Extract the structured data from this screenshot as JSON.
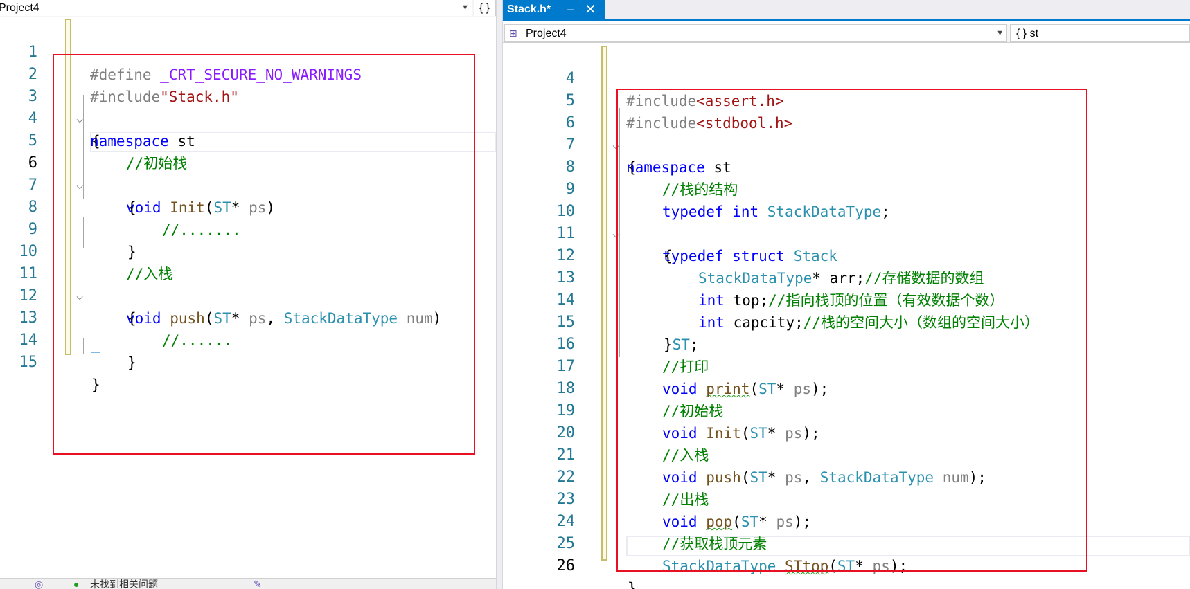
{
  "left_editor": {
    "project_combo": "Project4",
    "member_combo": "{ }",
    "lines": [
      {
        "n": "1"
      },
      {
        "n": "2"
      },
      {
        "n": "3"
      },
      {
        "n": "4"
      },
      {
        "n": "5"
      },
      {
        "n": "6"
      },
      {
        "n": "7"
      },
      {
        "n": "8"
      },
      {
        "n": "9"
      },
      {
        "n": "10"
      },
      {
        "n": "11"
      },
      {
        "n": "12"
      },
      {
        "n": "13"
      },
      {
        "n": "14"
      },
      {
        "n": "15"
      }
    ],
    "tokens": {
      "define": "#define",
      "crt_macro": "_CRT_SECURE_NO_WARNINGS",
      "include": "#include",
      "stack_h": "\"Stack.h\"",
      "namespace": "namespace",
      "st": " st",
      "lbrace": "{",
      "rbrace": "}",
      "cm_init": "//初始栈",
      "void": "void",
      "init": "Init",
      "lparen": "(",
      "ST": "ST",
      "star": "*",
      "ps": "ps",
      "rparen": ")",
      "comma": ",",
      "dots7": "//.......",
      "cm_push": "//入栈",
      "push": "push",
      "sdt": "StackDataType",
      "num": "num",
      "dots6": "//......"
    }
  },
  "right_editor": {
    "tab_label": "Stack.h*",
    "tab_pin": "⊣",
    "tab_close": "✕",
    "project_combo": "Project4",
    "member_combo": "{ } st",
    "lines": [
      {
        "n": "4"
      },
      {
        "n": "5"
      },
      {
        "n": "6"
      },
      {
        "n": "7"
      },
      {
        "n": "8"
      },
      {
        "n": "9"
      },
      {
        "n": "10"
      },
      {
        "n": "11"
      },
      {
        "n": "12"
      },
      {
        "n": "13"
      },
      {
        "n": "14"
      },
      {
        "n": "15"
      },
      {
        "n": "16"
      },
      {
        "n": "17"
      },
      {
        "n": "18"
      },
      {
        "n": "19"
      },
      {
        "n": "20"
      },
      {
        "n": "21"
      },
      {
        "n": "22"
      },
      {
        "n": "23"
      },
      {
        "n": "24"
      },
      {
        "n": "25"
      },
      {
        "n": "26"
      }
    ],
    "tokens": {
      "include": "#include",
      "assert_h": "<assert.h>",
      "stdbool_h": "<stdbool.h>",
      "namespace": "namespace",
      "st": " st",
      "lbrace": "{",
      "cm_struct": "//栈的结构",
      "typedef": "typedef",
      "int": "int",
      "sdt": "StackDataType",
      "semi": ";",
      "struct": "struct",
      "Stack": "Stack",
      "star": "*",
      "arr": " arr;",
      "cm_arr": "//存储数据的数组",
      "top": " top;",
      "cm_top": "//指向栈顶的位置（有效数据个数）",
      "capcity": " capcity;",
      "cm_cap": "//栈的空间大小（数组的空间大小）",
      "rbrace": "}",
      "ST": "ST",
      "cm_print": "//打印",
      "void": "void",
      "print": "print",
      "lparen": "(",
      "ps": "ps",
      "rparen_semi": ");",
      "cm_init": "//初始栈",
      "Init": "Init",
      "cm_push": "//入栈",
      "push": "push",
      "comma": ",",
      "num": "num",
      "cm_pop": "//出栈",
      "pop": "pop",
      "cm_top2": "//获取栈顶元素",
      "STtop": "STtop"
    }
  },
  "status_bar": {
    "issues_text": "未找到相关问题"
  },
  "colors": {
    "keyword": "#0000ff",
    "type": "#2b91af",
    "comment": "#008000",
    "function": "#74531f",
    "macro": "#8a1bff",
    "string": "#a31515",
    "highlight_box": "#e81123",
    "tab_active": "#007acc"
  }
}
